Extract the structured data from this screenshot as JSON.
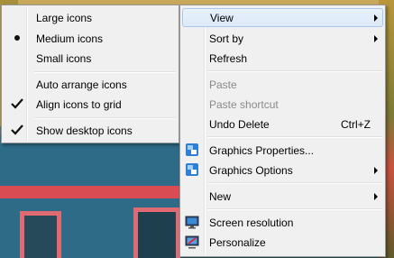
{
  "context_menu": {
    "items": [
      {
        "label": "View",
        "submenu": true,
        "highlighted": true
      },
      {
        "label": "Sort by",
        "submenu": true
      },
      {
        "label": "Refresh"
      },
      {
        "label": "Paste",
        "disabled": true
      },
      {
        "label": "Paste shortcut",
        "disabled": true
      },
      {
        "label": "Undo Delete",
        "shortcut": "Ctrl+Z"
      },
      {
        "label": "Graphics Properties...",
        "icon": "intel-graphics-icon"
      },
      {
        "label": "Graphics Options",
        "icon": "intel-graphics-icon",
        "submenu": true
      },
      {
        "label": "New",
        "submenu": true
      },
      {
        "label": "Screen resolution",
        "icon": "monitor-icon"
      },
      {
        "label": "Personalize",
        "icon": "personalize-monitor-icon"
      }
    ]
  },
  "view_submenu": {
    "items": [
      {
        "label": "Large icons",
        "selected": false
      },
      {
        "label": "Medium icons",
        "selected": true,
        "mark": "radio-dot"
      },
      {
        "label": "Small icons",
        "selected": false
      },
      {
        "label": "Auto arrange icons",
        "checked": false
      },
      {
        "label": "Align icons to grid",
        "checked": true
      },
      {
        "label": "Show desktop icons",
        "checked": true
      }
    ]
  },
  "colors": {
    "highlight": "#dce9f8",
    "menu_bg": "#f0f0f0",
    "disabled_text": "#8a8a8a"
  }
}
